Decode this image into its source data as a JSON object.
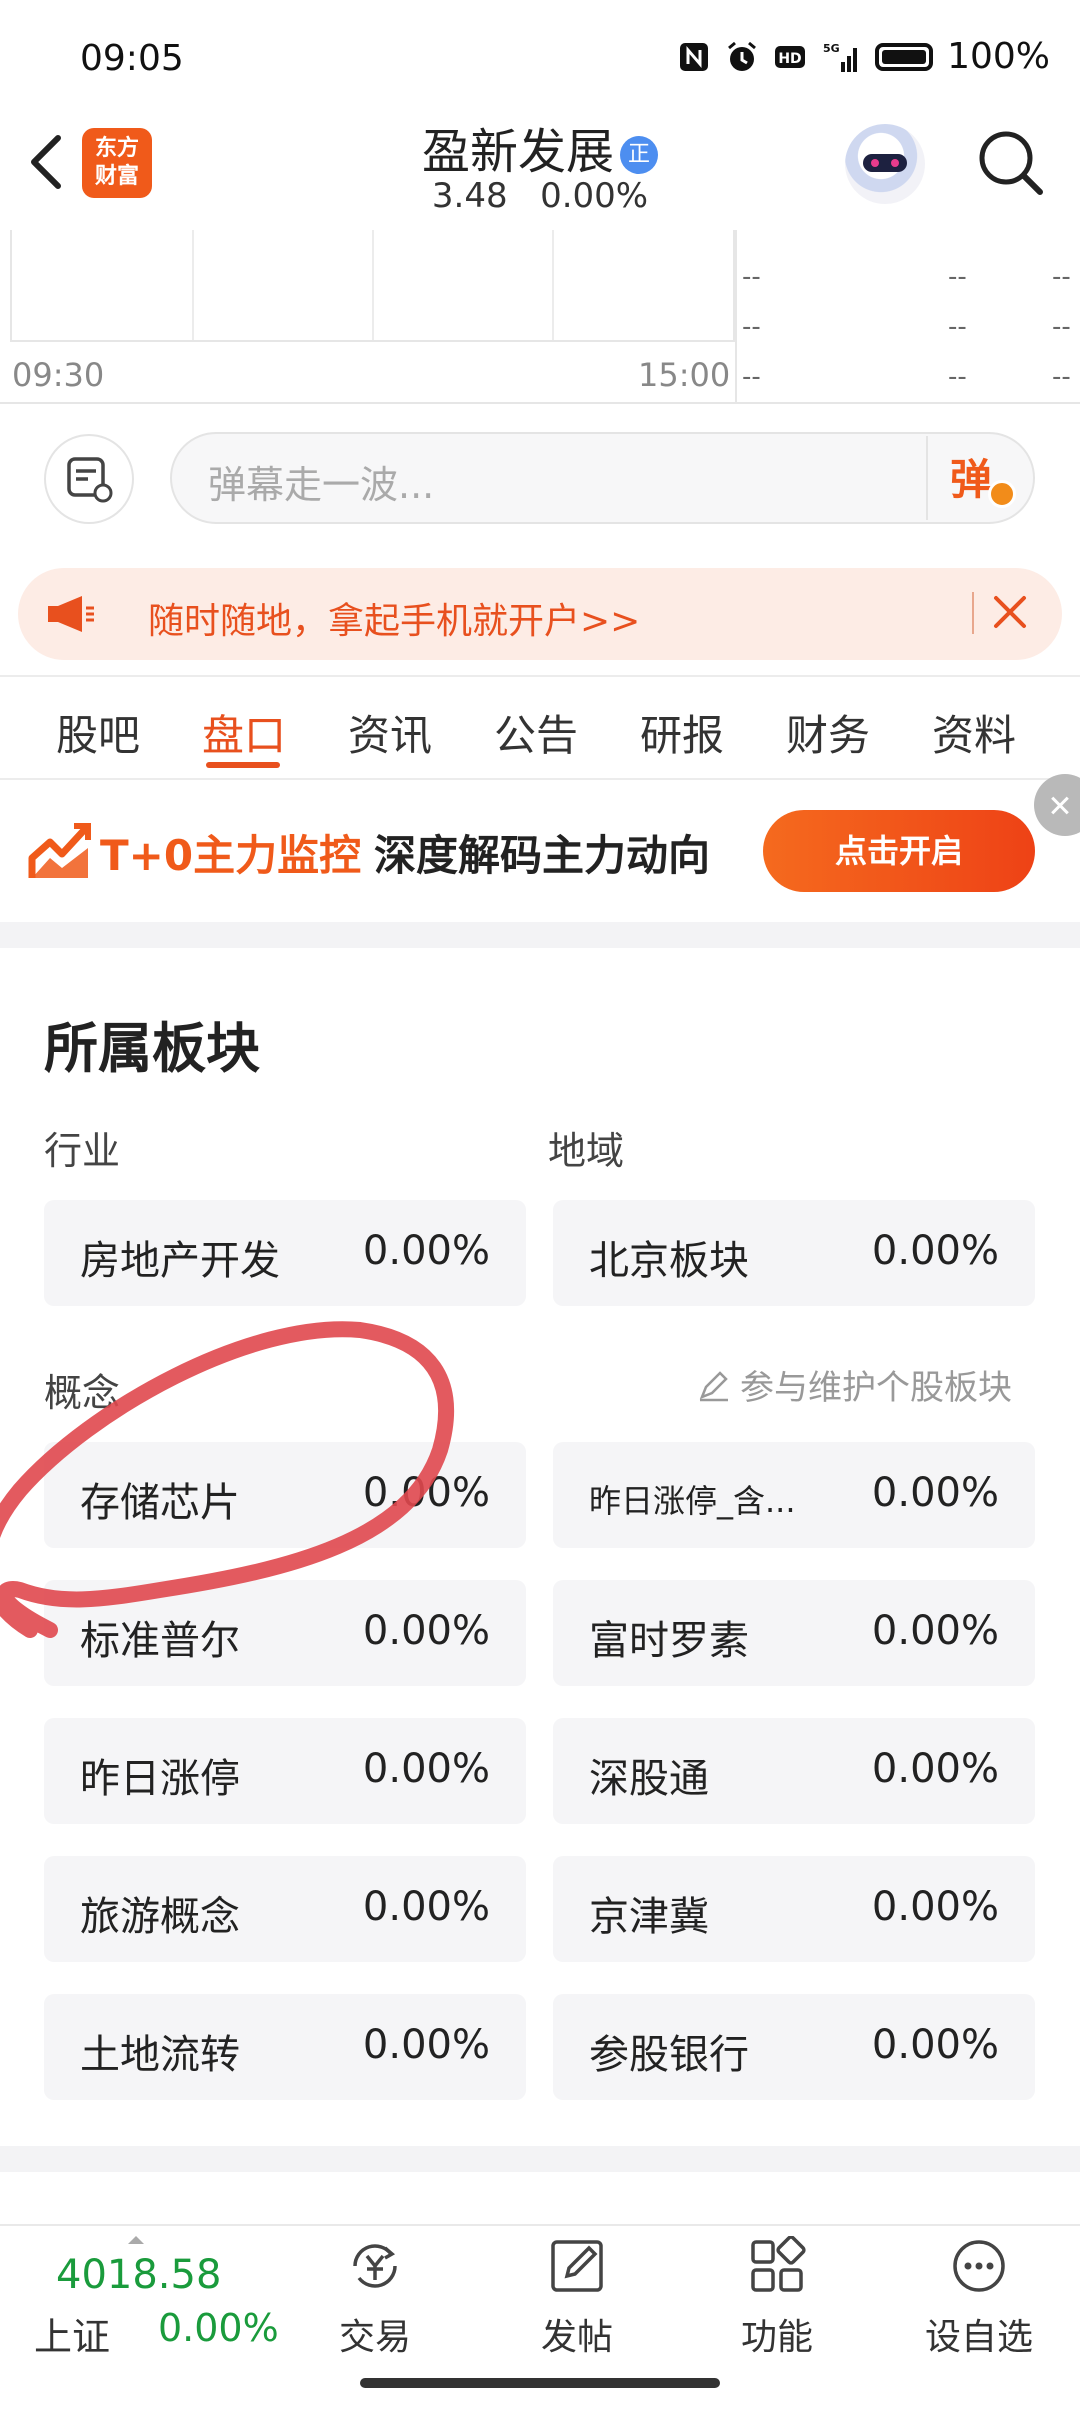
{
  "status_bar": {
    "time": "09:05",
    "battery": "100%",
    "network": "5G"
  },
  "header": {
    "logo_line1": "东方",
    "logo_line2": "财富",
    "stock_name": "盈新发展",
    "name_tag": "正",
    "price": "3.48",
    "change": "0.00%"
  },
  "chart": {
    "time_start": "09:30",
    "time_end": "15:00",
    "placeholder": "--"
  },
  "danmaku": {
    "placeholder": "弹幕走一波...",
    "send_label": "弹"
  },
  "promo": {
    "text": "随时随地，拿起手机就开户>>"
  },
  "tabs": [
    {
      "label": "股吧"
    },
    {
      "label": "盘口"
    },
    {
      "label": "资讯"
    },
    {
      "label": "公告"
    },
    {
      "label": "研报"
    },
    {
      "label": "财务"
    },
    {
      "label": "资料"
    }
  ],
  "active_tab": "盘口",
  "ad": {
    "title": "T+0主力监控",
    "subtitle": "深度解码主力动向",
    "button": "点击开启"
  },
  "sectors": {
    "title": "所属板块",
    "industry_label": "行业",
    "region_label": "地域",
    "concept_label": "概念",
    "edit_link": "参与维护个股板块",
    "industry": {
      "name": "房地产开发",
      "value": "0.00%"
    },
    "region": {
      "name": "北京板块",
      "value": "0.00%"
    },
    "concepts": [
      {
        "name": "存储芯片",
        "value": "0.00%"
      },
      {
        "name": "昨日涨停_含...",
        "value": "0.00%"
      },
      {
        "name": "标准普尔",
        "value": "0.00%"
      },
      {
        "name": "富时罗素",
        "value": "0.00%"
      },
      {
        "name": "昨日涨停",
        "value": "0.00%"
      },
      {
        "name": "深股通",
        "value": "0.00%"
      },
      {
        "name": "旅游概念",
        "value": "0.00%"
      },
      {
        "name": "京津冀",
        "value": "0.00%"
      },
      {
        "name": "土地流转",
        "value": "0.00%"
      },
      {
        "name": "参股银行",
        "value": "0.00%"
      }
    ]
  },
  "bottom_nav": {
    "index_value": "4018.58",
    "index_name": "上证",
    "index_change": "0.00%",
    "items": [
      {
        "label": "交易",
        "icon": "yuan-exchange-icon"
      },
      {
        "label": "发帖",
        "icon": "edit-post-icon"
      },
      {
        "label": "功能",
        "icon": "grid-icon"
      },
      {
        "label": "设自选",
        "icon": "more-icon"
      }
    ]
  },
  "colors": {
    "accent": "#e8501e",
    "up_green": "#1a9b3c",
    "annotation": "#e0484e"
  }
}
